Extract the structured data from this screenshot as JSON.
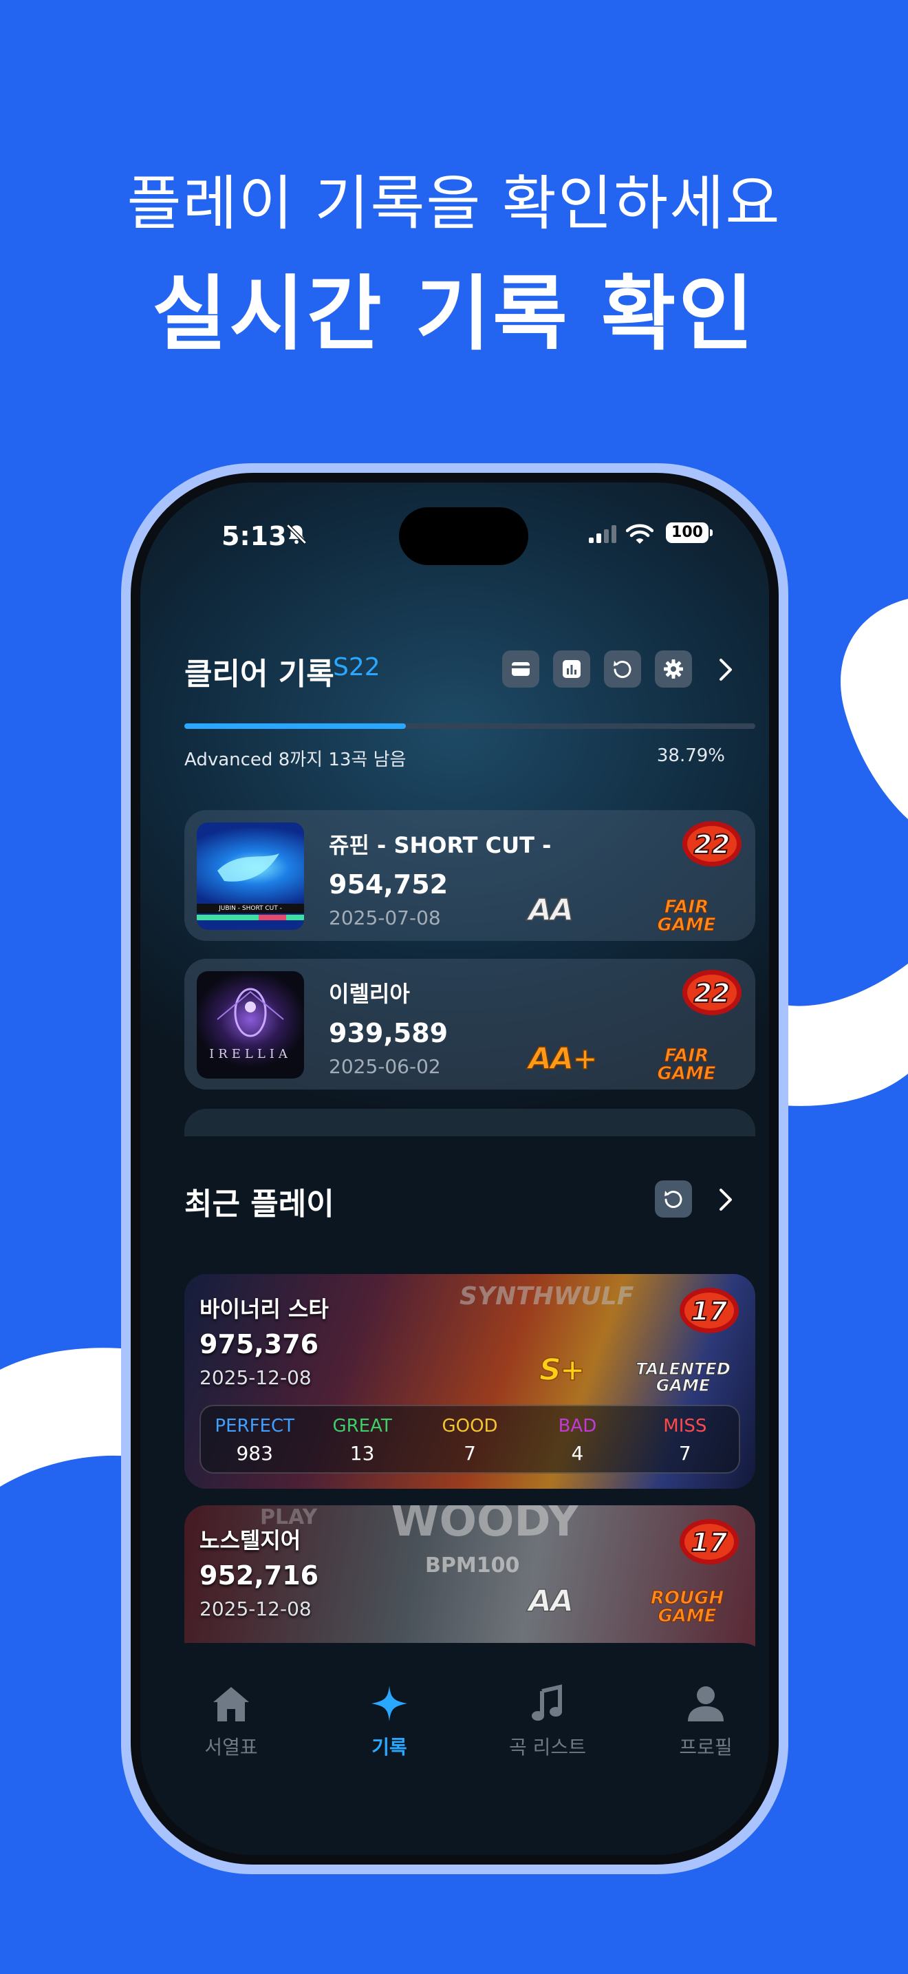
{
  "promo": {
    "subtitle": "플레이 기록을 확인하세요",
    "title": "실시간 기록 확인"
  },
  "status_bar": {
    "time": "5:13",
    "battery": "100"
  },
  "clear_records": {
    "title": "클리어 기록",
    "season": "S22",
    "progress_text": "Advanced 8까지 13곡 남음",
    "progress_percent": "38.79%",
    "progress_fraction": 0.3879,
    "items": [
      {
        "title": "쥬핀 - SHORT CUT -",
        "score": "954,752",
        "date": "2025-07-08",
        "level": "22",
        "rank": "AA",
        "judgement": [
          "FAIR",
          "GAME"
        ],
        "thumb_text": "JUBIN - SHORT CUT -"
      },
      {
        "title": "이렐리아",
        "score": "939,589",
        "date": "2025-06-02",
        "level": "22",
        "rank": "AA+",
        "judgement": [
          "FAIR",
          "GAME"
        ],
        "thumb_text": "IRELLIA"
      }
    ]
  },
  "recent_plays": {
    "title": "최근 플레이",
    "items": [
      {
        "title": "바이너리 스타",
        "score": "975,376",
        "date": "2025-12-08",
        "level": "17",
        "rank": "S+",
        "judgement": [
          "TALENTED",
          "GAME"
        ],
        "art_text": "SYNTHWULF",
        "counts": [
          {
            "label": "PERFECT",
            "value": "983",
            "color": "#3fa0ff"
          },
          {
            "label": "GREAT",
            "value": "13",
            "color": "#3ecf6a"
          },
          {
            "label": "GOOD",
            "value": "7",
            "color": "#f2c531"
          },
          {
            "label": "BAD",
            "value": "4",
            "color": "#c23ad6"
          },
          {
            "label": "MISS",
            "value": "7",
            "color": "#ff4a4a"
          }
        ]
      },
      {
        "title": "노스텔지어",
        "score": "952,716",
        "date": "2025-12-08",
        "level": "17",
        "rank": "AA",
        "judgement": [
          "ROUGH",
          "GAME"
        ],
        "art_text": "WOODY",
        "art_sub": "BPM100",
        "art_top": "PLAY"
      }
    ]
  },
  "tabs": [
    {
      "label": "서열표",
      "icon": "home-icon"
    },
    {
      "label": "기록",
      "icon": "sparkle-icon"
    },
    {
      "label": "곡 리스트",
      "icon": "music-note-icon"
    },
    {
      "label": "프로필",
      "icon": "person-icon"
    }
  ],
  "colors": {
    "background": "#2364f0",
    "accent": "#2aa7ff",
    "frame": "#a9c3ff"
  }
}
